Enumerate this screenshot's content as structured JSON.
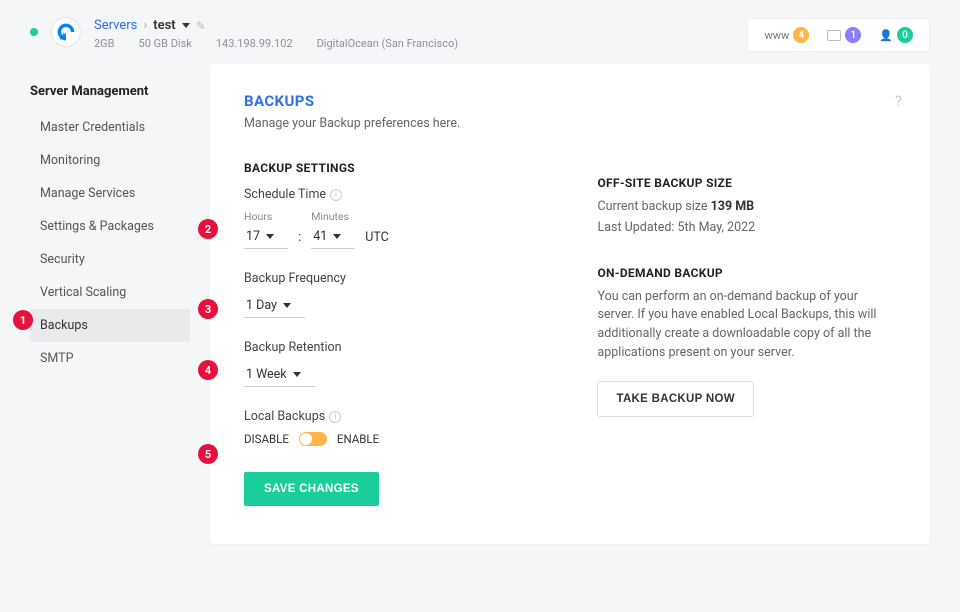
{
  "header": {
    "breadcrumb": {
      "root": "Servers",
      "current": "test"
    },
    "meta": {
      "ram": "2GB",
      "disk": "50 GB Disk",
      "ip": "143.198.99.102",
      "provider": "DigitalOcean (San Francisco)"
    },
    "pills": {
      "www_label": "www",
      "www_count": "4",
      "inbox_count": "1",
      "user_count": "0"
    }
  },
  "sidebar": {
    "title": "Server Management",
    "items": [
      "Master Credentials",
      "Monitoring",
      "Manage Services",
      "Settings & Packages",
      "Security",
      "Vertical Scaling",
      "Backups",
      "SMTP"
    ],
    "active_index": 6
  },
  "page": {
    "title": "BACKUPS",
    "subtitle": "Manage your Backup preferences here."
  },
  "settings": {
    "heading": "BACKUP SETTINGS",
    "schedule_label": "Schedule Time",
    "hours_label": "Hours",
    "minutes_label": "Minutes",
    "hours_value": "17",
    "minutes_value": "41",
    "tz": "UTC",
    "freq_label": "Backup Frequency",
    "freq_value": "1 Day",
    "retention_label": "Backup Retention",
    "retention_value": "1 Week",
    "local_label": "Local Backups",
    "disable_text": "DISABLE",
    "enable_text": "ENABLE",
    "save_button": "SAVE CHANGES"
  },
  "right": {
    "size_heading": "OFF-SITE BACKUP SIZE",
    "size_prefix": "Current backup size ",
    "size_value": "139 MB",
    "updated_label": "Last Updated: 5th May, 2022",
    "ondemand_heading": "ON-DEMAND BACKUP",
    "ondemand_text": "You can perform an on-demand backup of your server. If you have enabled Local Backups, this will additionally create a downloadable copy of all the applications present on your server.",
    "take_backup_button": "TAKE BACKUP NOW"
  },
  "callouts": [
    "1",
    "2",
    "3",
    "4",
    "5"
  ]
}
